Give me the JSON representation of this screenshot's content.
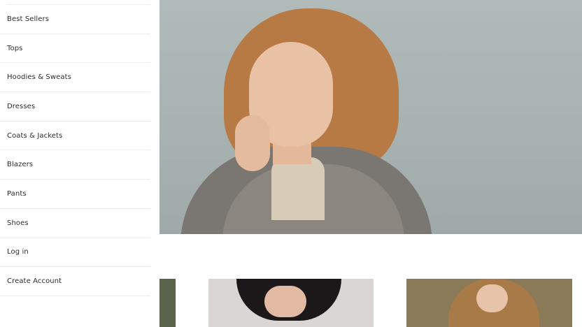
{
  "menu": {
    "items": [
      {
        "label": "Best Sellers"
      },
      {
        "label": "Tops"
      },
      {
        "label": "Hoodies & Sweats"
      },
      {
        "label": "Dresses"
      },
      {
        "label": "Coats & Jackets"
      },
      {
        "label": "Blazers"
      },
      {
        "label": "Pants"
      },
      {
        "label": "Shoes"
      },
      {
        "label": "Log in"
      },
      {
        "label": "Create Account"
      }
    ]
  },
  "colors": {
    "drawer_bg": "#ffffff",
    "divider": "#ececec",
    "text": "#2b2b2b",
    "hero_bg": "#a9b4b3"
  }
}
